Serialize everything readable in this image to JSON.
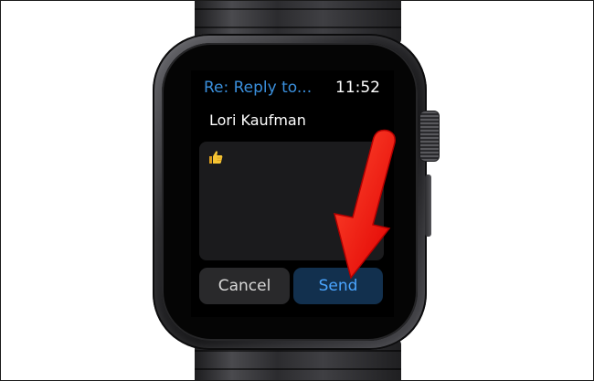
{
  "colors": {
    "accent_blue": "#3a8fdc",
    "send_text": "#4aa5ff",
    "send_bg": "#12304e",
    "cancel_bg": "#29292b",
    "screen_bg": "#000000",
    "arrow_red": "#ff1a0a"
  },
  "header": {
    "subject": "Re: Reply to...",
    "time": "11:52"
  },
  "message": {
    "sender": "Lori Kaufman",
    "body_icon": "thumbs-up-icon"
  },
  "actions": {
    "cancel_label": "Cancel",
    "send_label": "Send"
  },
  "annotation": {
    "icon": "red-arrow-icon"
  }
}
